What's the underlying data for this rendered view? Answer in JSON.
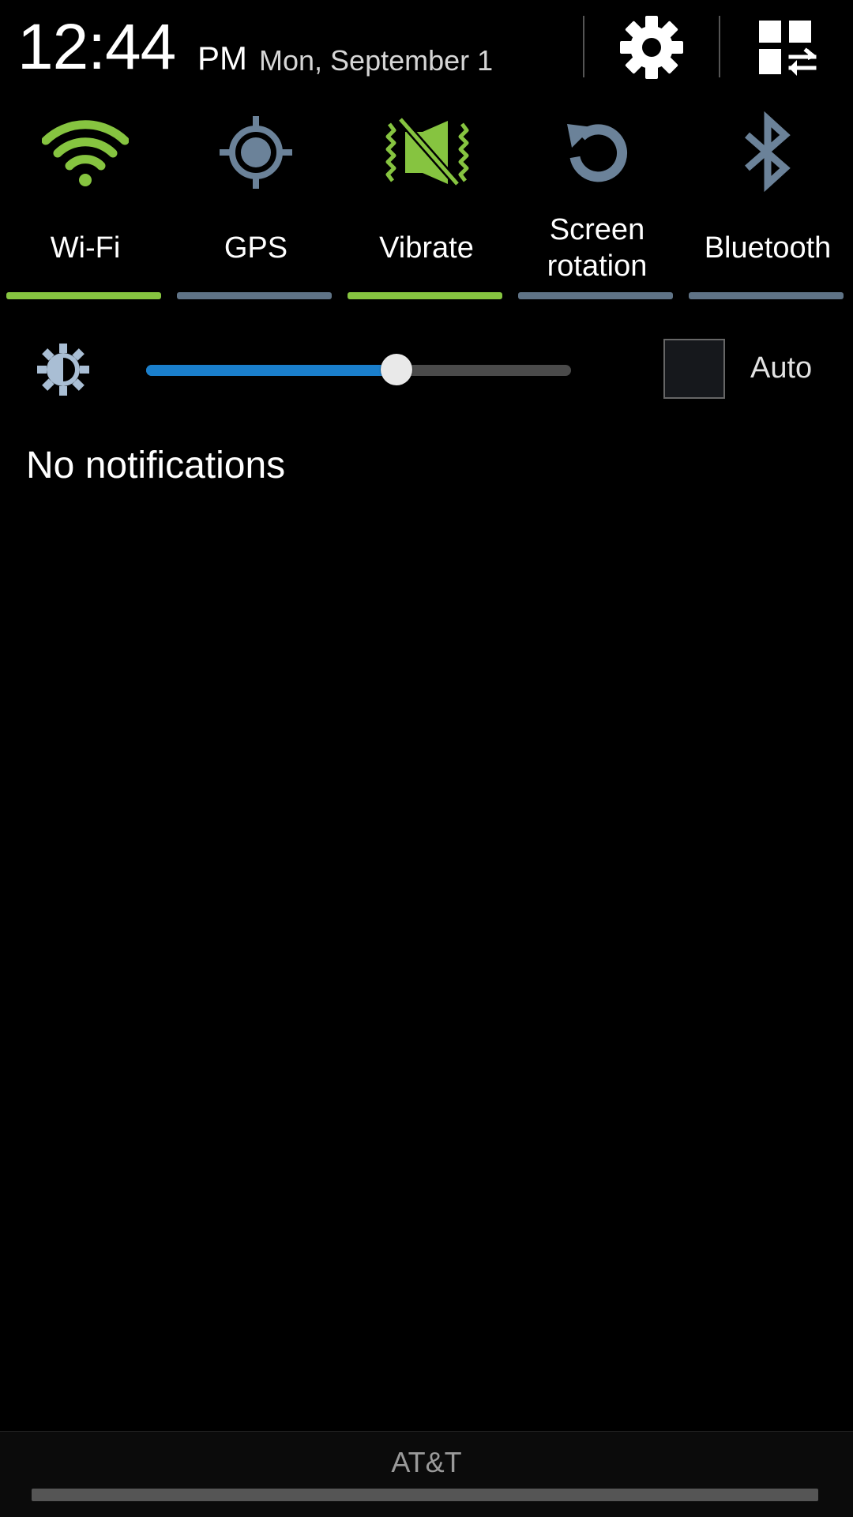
{
  "header": {
    "time": "12:44",
    "ampm": "PM",
    "date": "Mon, September 1",
    "settings_icon": "gear-icon",
    "edit_icon": "quick-panel-edit-icon"
  },
  "toggles": [
    {
      "label": "Wi-Fi",
      "icon": "wifi-icon",
      "active": true
    },
    {
      "label": "GPS",
      "icon": "gps-icon",
      "active": false
    },
    {
      "label": "Vibrate",
      "icon": "vibrate-icon",
      "active": true
    },
    {
      "label": "Screen rotation",
      "icon": "screen-rotation-icon",
      "active": false
    },
    {
      "label": "Bluetooth",
      "icon": "bluetooth-icon",
      "active": false
    }
  ],
  "brightness": {
    "icon": "brightness-icon",
    "level_percent": 59,
    "auto_label": "Auto",
    "auto_checked": false
  },
  "notifications": {
    "empty_text": "No notifications"
  },
  "footer": {
    "carrier": "AT&T"
  },
  "colors": {
    "active": "#86c440",
    "inactive": "#6b8299",
    "inactive_bar": "#5f7386",
    "slider_fill": "#1a7fcc",
    "background": "#000000"
  }
}
